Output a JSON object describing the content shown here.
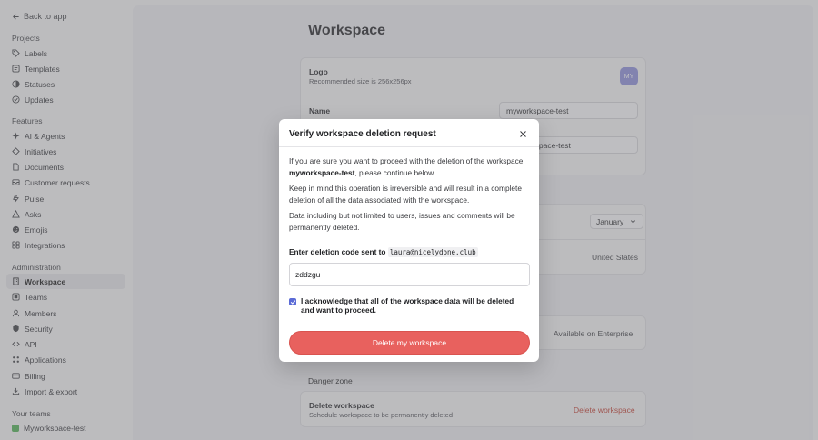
{
  "sidebar": {
    "back_label": "Back to app",
    "sections": [
      {
        "title": "Projects",
        "items": [
          {
            "label": "Labels",
            "icon": "tag-icon"
          },
          {
            "label": "Templates",
            "icon": "template-icon"
          },
          {
            "label": "Statuses",
            "icon": "status-icon"
          },
          {
            "label": "Updates",
            "icon": "updates-icon"
          }
        ]
      },
      {
        "title": "Features",
        "items": [
          {
            "label": "AI & Agents",
            "icon": "sparkle-icon"
          },
          {
            "label": "Initiatives",
            "icon": "initiative-icon"
          },
          {
            "label": "Documents",
            "icon": "document-icon"
          },
          {
            "label": "Customer requests",
            "icon": "inbox-icon"
          },
          {
            "label": "Pulse",
            "icon": "pulse-icon"
          },
          {
            "label": "Asks",
            "icon": "ask-icon"
          },
          {
            "label": "Emojis",
            "icon": "emoji-icon"
          },
          {
            "label": "Integrations",
            "icon": "integrations-icon"
          }
        ]
      },
      {
        "title": "Administration",
        "items": [
          {
            "label": "Workspace",
            "icon": "building-icon",
            "active": true
          },
          {
            "label": "Teams",
            "icon": "teams-icon"
          },
          {
            "label": "Members",
            "icon": "members-icon"
          },
          {
            "label": "Security",
            "icon": "shield-icon"
          },
          {
            "label": "API",
            "icon": "code-icon"
          },
          {
            "label": "Applications",
            "icon": "apps-icon"
          },
          {
            "label": "Billing",
            "icon": "card-icon"
          },
          {
            "label": "Import & export",
            "icon": "import-icon"
          }
        ]
      },
      {
        "title": "Your teams",
        "items": [
          {
            "label": "Myworkspace-test",
            "icon": "team-icon"
          }
        ]
      }
    ]
  },
  "main": {
    "title": "Workspace",
    "logo_label": "Logo",
    "logo_sub": "Recommended size is 256x256px",
    "logo_initials": "MY",
    "name_label": "Name",
    "name_value": "myworkspace-test",
    "url_value": "/myworkspace-test",
    "month_value": "January",
    "region_value": "United States",
    "enterprise_text": "Available on Enterprise",
    "danger_zone_title": "Danger zone",
    "delete_label": "Delete workspace",
    "delete_sub": "Schedule workspace to be permanently deleted",
    "delete_link": "Delete workspace"
  },
  "modal": {
    "title": "Verify workspace deletion request",
    "p1_pre": "If you are sure you want to proceed with the deletion of the workspace ",
    "p1_bold": "myworkspace-test",
    "p1_post": ", please continue below.",
    "p2": "Keep in mind this operation is irreversible and will result in a complete deletion of all the data associated with the workspace.",
    "p3": "Data including but not limited to users, issues and comments will be permanently deleted.",
    "code_label": "Enter deletion code sent to",
    "email": "laura@nicelydone.club",
    "code_value": "zddzgu",
    "ack_label": "I acknowledge that all of the workspace data will be deleted and want to proceed.",
    "button_label": "Delete my workspace"
  },
  "colors": {
    "accent": "#5b6bd6",
    "danger": "#e8615e",
    "logo_badge": "#8a8cd9"
  }
}
